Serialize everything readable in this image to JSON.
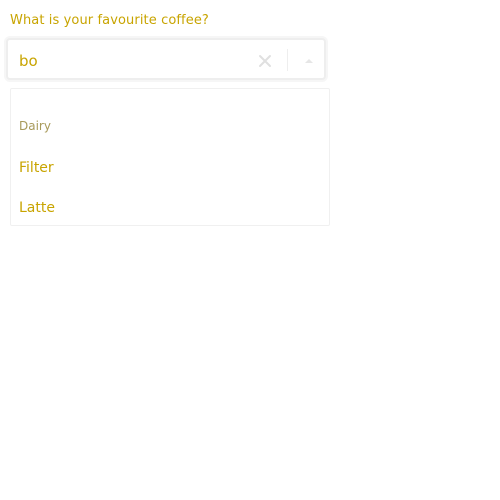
{
  "question": {
    "label": "What is your favourite coffee?"
  },
  "combobox": {
    "value": "bo",
    "clear_icon": "close-icon",
    "toggle_icon": "triangle-up-icon"
  },
  "menu": {
    "group_label": "Dairy",
    "options": [
      "Filter",
      "Latte"
    ]
  },
  "colors": {
    "accent": "#c8a400",
    "muted": "#a89a5a",
    "border": "#eeeeee"
  }
}
